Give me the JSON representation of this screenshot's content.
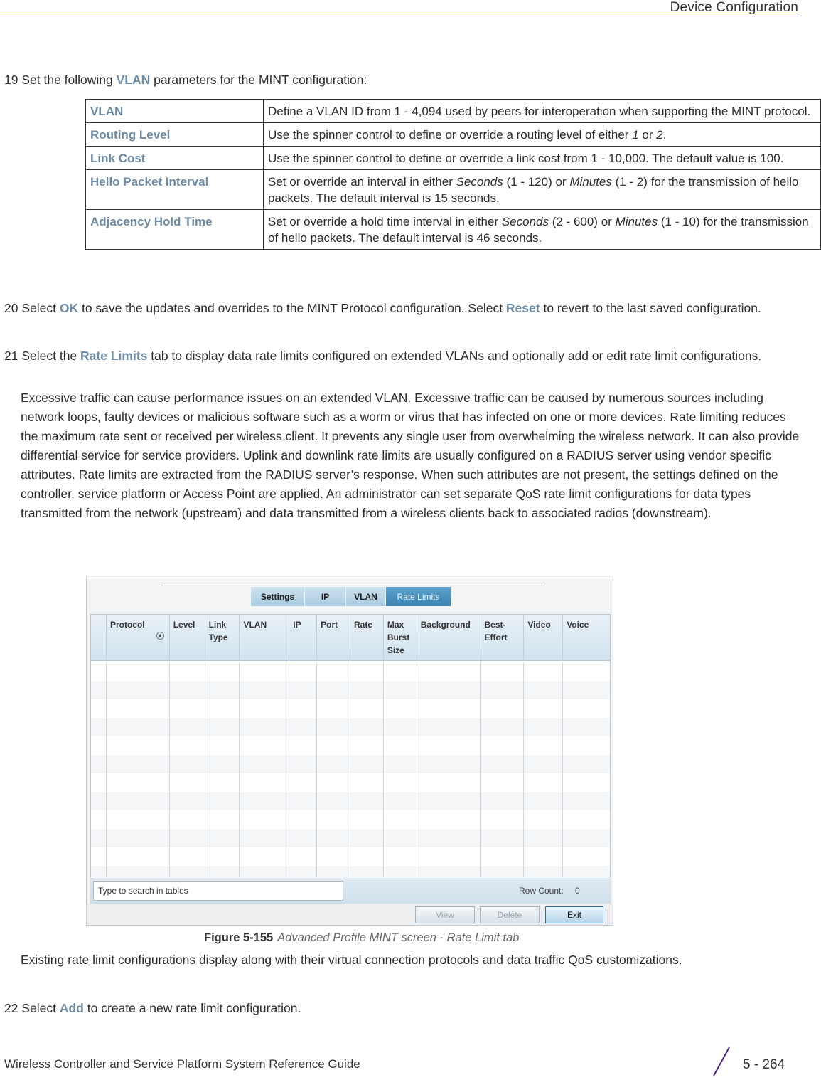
{
  "header": {
    "title": "Device Configuration",
    "rule_color": "#4b2583"
  },
  "step19": {
    "num": "19",
    "before": "Set the following ",
    "kw": "VLAN",
    "after": " parameters for the MINT configuration:"
  },
  "params_table": [
    {
      "term": "VLAN",
      "desc": "Define a VLAN ID from 1 - 4,094 used by peers for interoperation when supporting the MINT protocol."
    },
    {
      "term": "Routing Level",
      "desc_parts": [
        "Use the spinner control to define or override a routing level of either ",
        "1",
        " or ",
        "2",
        "."
      ]
    },
    {
      "term": "Link Cost",
      "desc": "Use the spinner control to define or override a link cost from 1 - 10,000. The default value is 100."
    },
    {
      "term": "Hello Packet Interval",
      "desc_parts": [
        "Set or override an interval in either ",
        "Seconds",
        " (1 - 120) or ",
        "Minutes",
        " (1 - 2) for the transmission of hello packets. The default interval is 15 seconds."
      ]
    },
    {
      "term": "Adjacency Hold Time",
      "desc_parts": [
        "Set or override a hold time interval in either ",
        "Seconds",
        " (2 - 600) or ",
        "Minutes",
        " (1 - 10) for the transmission of hello packets. The default interval is 46 seconds."
      ]
    }
  ],
  "step20": {
    "num": "20",
    "t1": "Select ",
    "kw1": "OK",
    "t2": " to save the updates and overrides to the MINT Protocol configuration. Select ",
    "kw2": "Reset",
    "t3": " to revert to the last saved configuration."
  },
  "step21": {
    "num": "21",
    "t1": "Select the ",
    "kw1": "Rate Limits",
    "t2": " tab to display data rate limits configured on extended VLANs and optionally add or edit rate limit configurations."
  },
  "para1": "Excessive traffic can cause performance issues on an extended VLAN. Excessive traffic can be caused by numerous sources including network loops, faulty devices or malicious software such as a worm or virus that has infected on one or more devices. Rate limiting reduces the maximum rate sent or received per wireless client. It prevents any single user from overwhelming the wireless network. It can also provide differential service for service providers. Uplink and downlink rate limits are usually configured on a RADIUS server using vendor specific attributes. Rate limits are extracted from the RADIUS server’s response. When such attributes are not present, the settings defined on the controller, service platform or Access Point are applied. An administrator can set separate QoS rate limit configurations for data types transmitted from the network (upstream) and data transmitted from a wireless clients back to associated radios (downstream).",
  "figure": {
    "tabs": [
      {
        "label": "Settings",
        "active": false
      },
      {
        "label": "IP",
        "active": false
      },
      {
        "label": "VLAN",
        "active": false
      },
      {
        "label": "Rate Limits",
        "active": true
      }
    ],
    "columns": [
      "",
      "Protocol",
      "Level",
      "Link Type",
      "VLAN",
      "IP",
      "Port",
      "Rate",
      "Max Burst Size",
      "Background",
      "Best-Effort",
      "Video",
      "Voice"
    ],
    "rows": [],
    "search_placeholder": "Type to search in tables",
    "row_count_label": "Row Count:",
    "row_count": "0",
    "buttons": {
      "view": "View",
      "delete": "Delete",
      "exit": "Exit"
    }
  },
  "caption": {
    "label": "Figure 5-155",
    "text": "Advanced Profile MINT screen - Rate Limit tab"
  },
  "para2": "Existing rate limit configurations display along with their virtual connection protocols and data traffic QoS customizations.",
  "step22": {
    "num": "22",
    "t1": "Select ",
    "kw1": "Add",
    "t2": " to create a new rate limit configuration."
  },
  "footer": {
    "title": "Wireless Controller and Service Platform System Reference Guide",
    "page": "5 - 264",
    "accent_color": "#4b2583"
  },
  "keyword_color": "#6e8ca6"
}
